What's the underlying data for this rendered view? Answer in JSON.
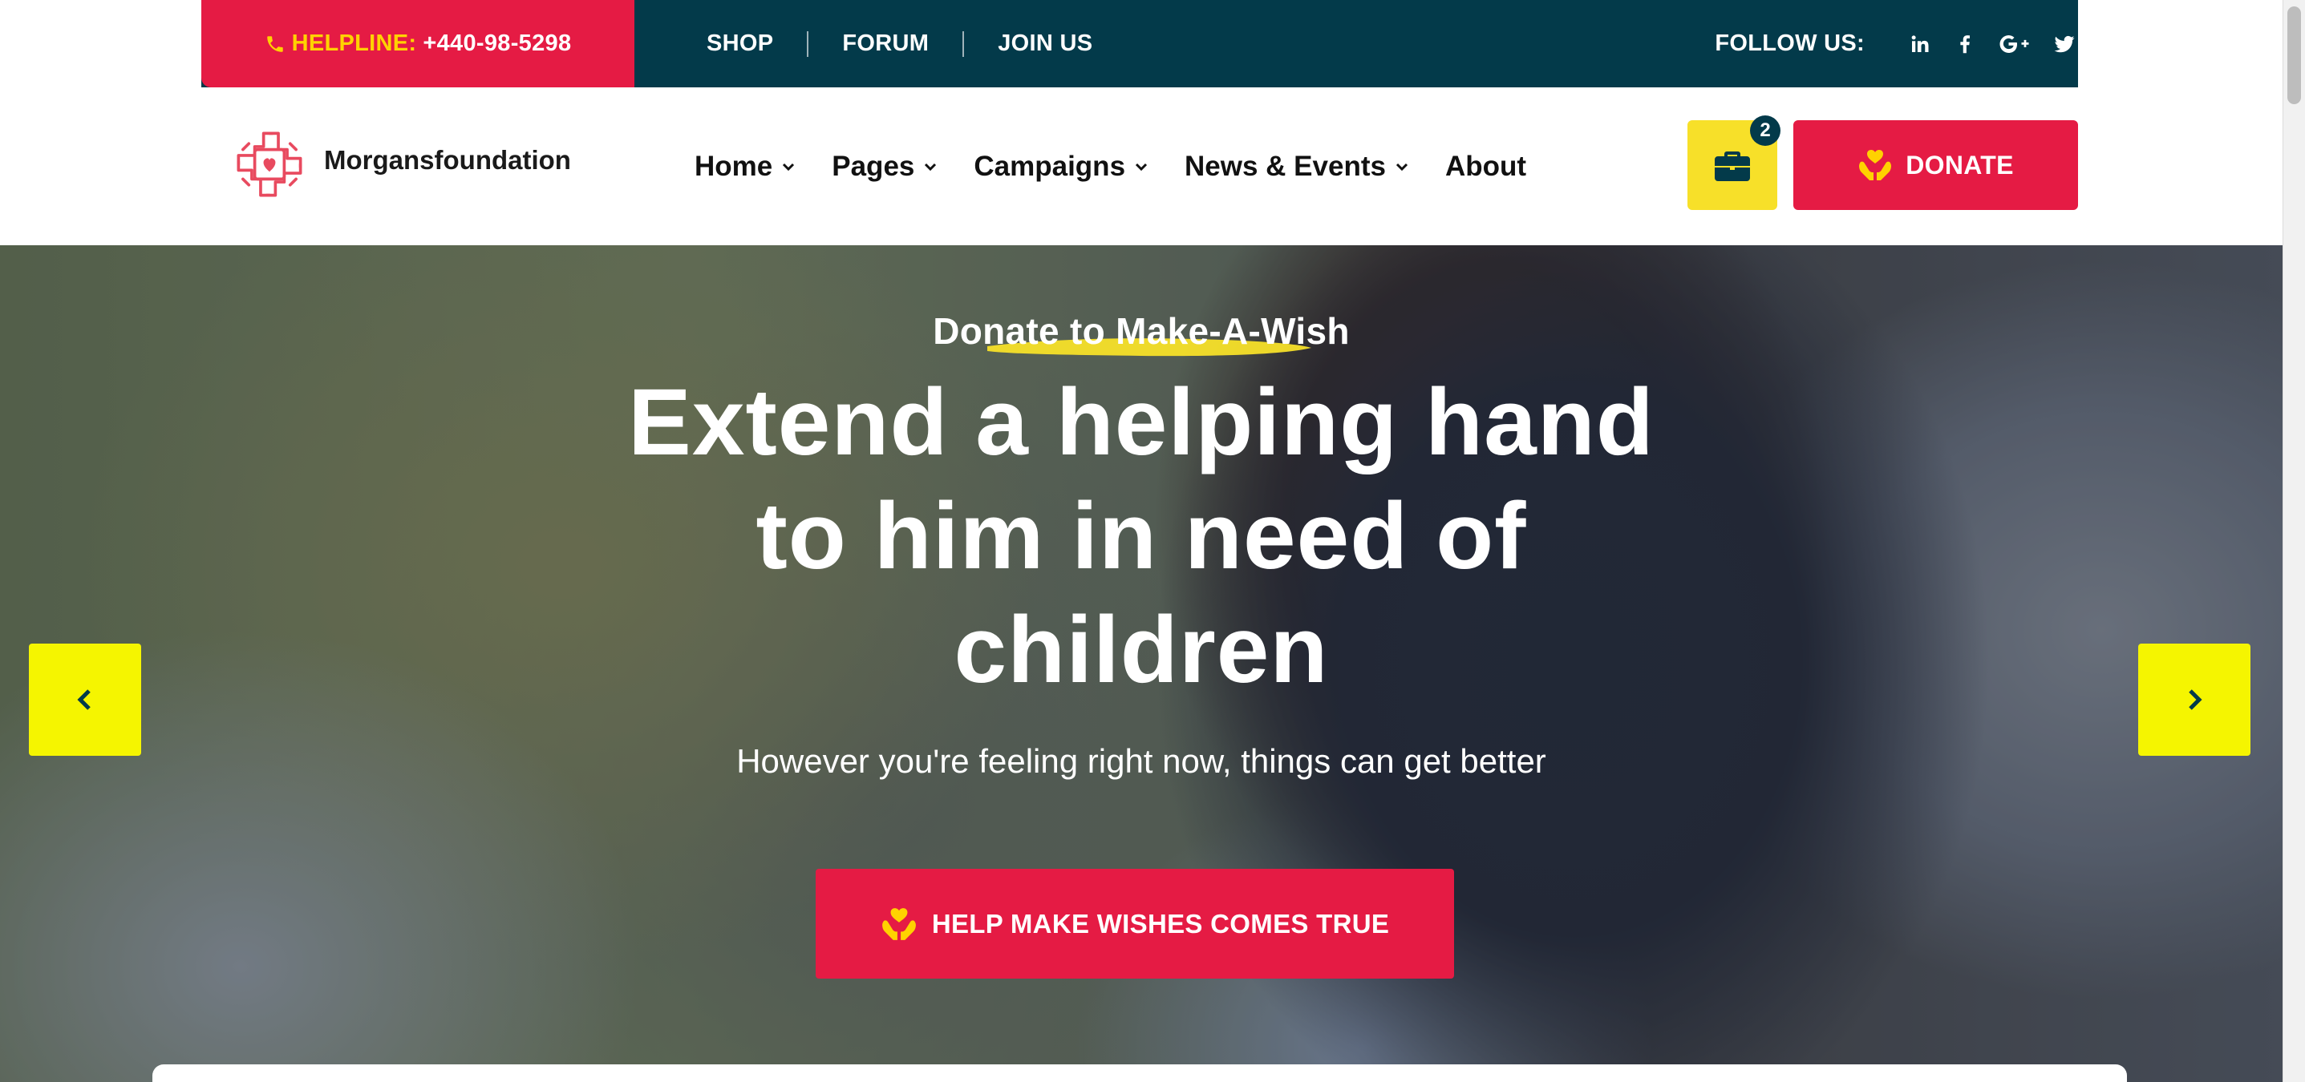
{
  "topbar": {
    "helpline_label": "HELPLINE:",
    "helpline_number": "+440-98-5298",
    "links": [
      "SHOP",
      "FORUM",
      "JOIN US"
    ],
    "follow_label": "FOLLOW US:",
    "socials": [
      "linkedin-icon",
      "facebook-icon",
      "google-plus-icon",
      "twitter-icon"
    ]
  },
  "header": {
    "brand": "Morgansfoundation",
    "nav": [
      {
        "label": "Home",
        "dropdown": true
      },
      {
        "label": "Pages",
        "dropdown": true
      },
      {
        "label": "Campaigns",
        "dropdown": true
      },
      {
        "label": "News & Events",
        "dropdown": true
      },
      {
        "label": "About",
        "dropdown": false
      }
    ],
    "cart_count": "2",
    "donate_label": "DONATE"
  },
  "hero": {
    "eyebrow": "Donate to Make-A-Wish",
    "title_lines": [
      "Extend a helping hand",
      "to him in need of",
      "children"
    ],
    "subtitle": "However you're feeling right now, things can get better",
    "cta_label": "HELP MAKE WISHES COMES TRUE"
  },
  "colors": {
    "primary_red": "#e51b44",
    "navy": "#033a4a",
    "yellow": "#f7e029",
    "arrow_yellow": "#f5f500"
  }
}
